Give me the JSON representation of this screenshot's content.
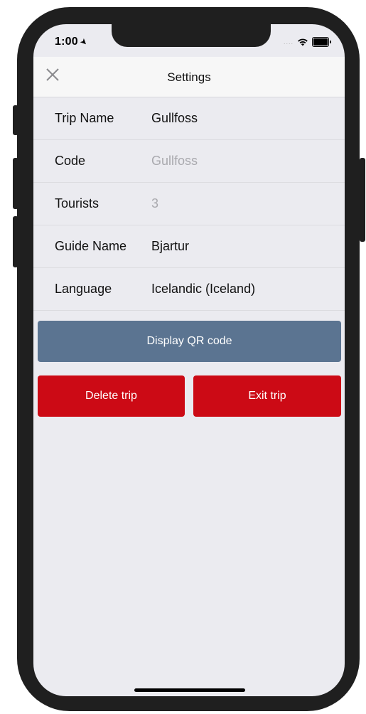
{
  "status_bar": {
    "time": "1:00",
    "location_arrow": "➤",
    "signal_dots": "....",
    "wifi_icon": "wifi-icon",
    "battery_icon": "battery-icon"
  },
  "nav": {
    "title": "Settings",
    "close_icon": "close-icon"
  },
  "form": {
    "rows": [
      {
        "label": "Trip Name",
        "value": "Gullfoss",
        "is_placeholder": false
      },
      {
        "label": "Code",
        "value": "Gullfoss",
        "is_placeholder": true
      },
      {
        "label": "Tourists",
        "value": "3",
        "is_placeholder": true
      },
      {
        "label": "Guide Name",
        "value": "Bjartur",
        "is_placeholder": false
      },
      {
        "label": "Language",
        "value": "Icelandic (Iceland)",
        "is_placeholder": false
      }
    ]
  },
  "actions": {
    "display_qr_label": "Display QR code",
    "delete_trip_label": "Delete trip",
    "exit_trip_label": "Exit trip"
  },
  "colors": {
    "qr_button": "#5b7491",
    "danger_button": "#cc0a15",
    "background": "#ebebf0",
    "placeholder_text": "#a9a9ae"
  }
}
